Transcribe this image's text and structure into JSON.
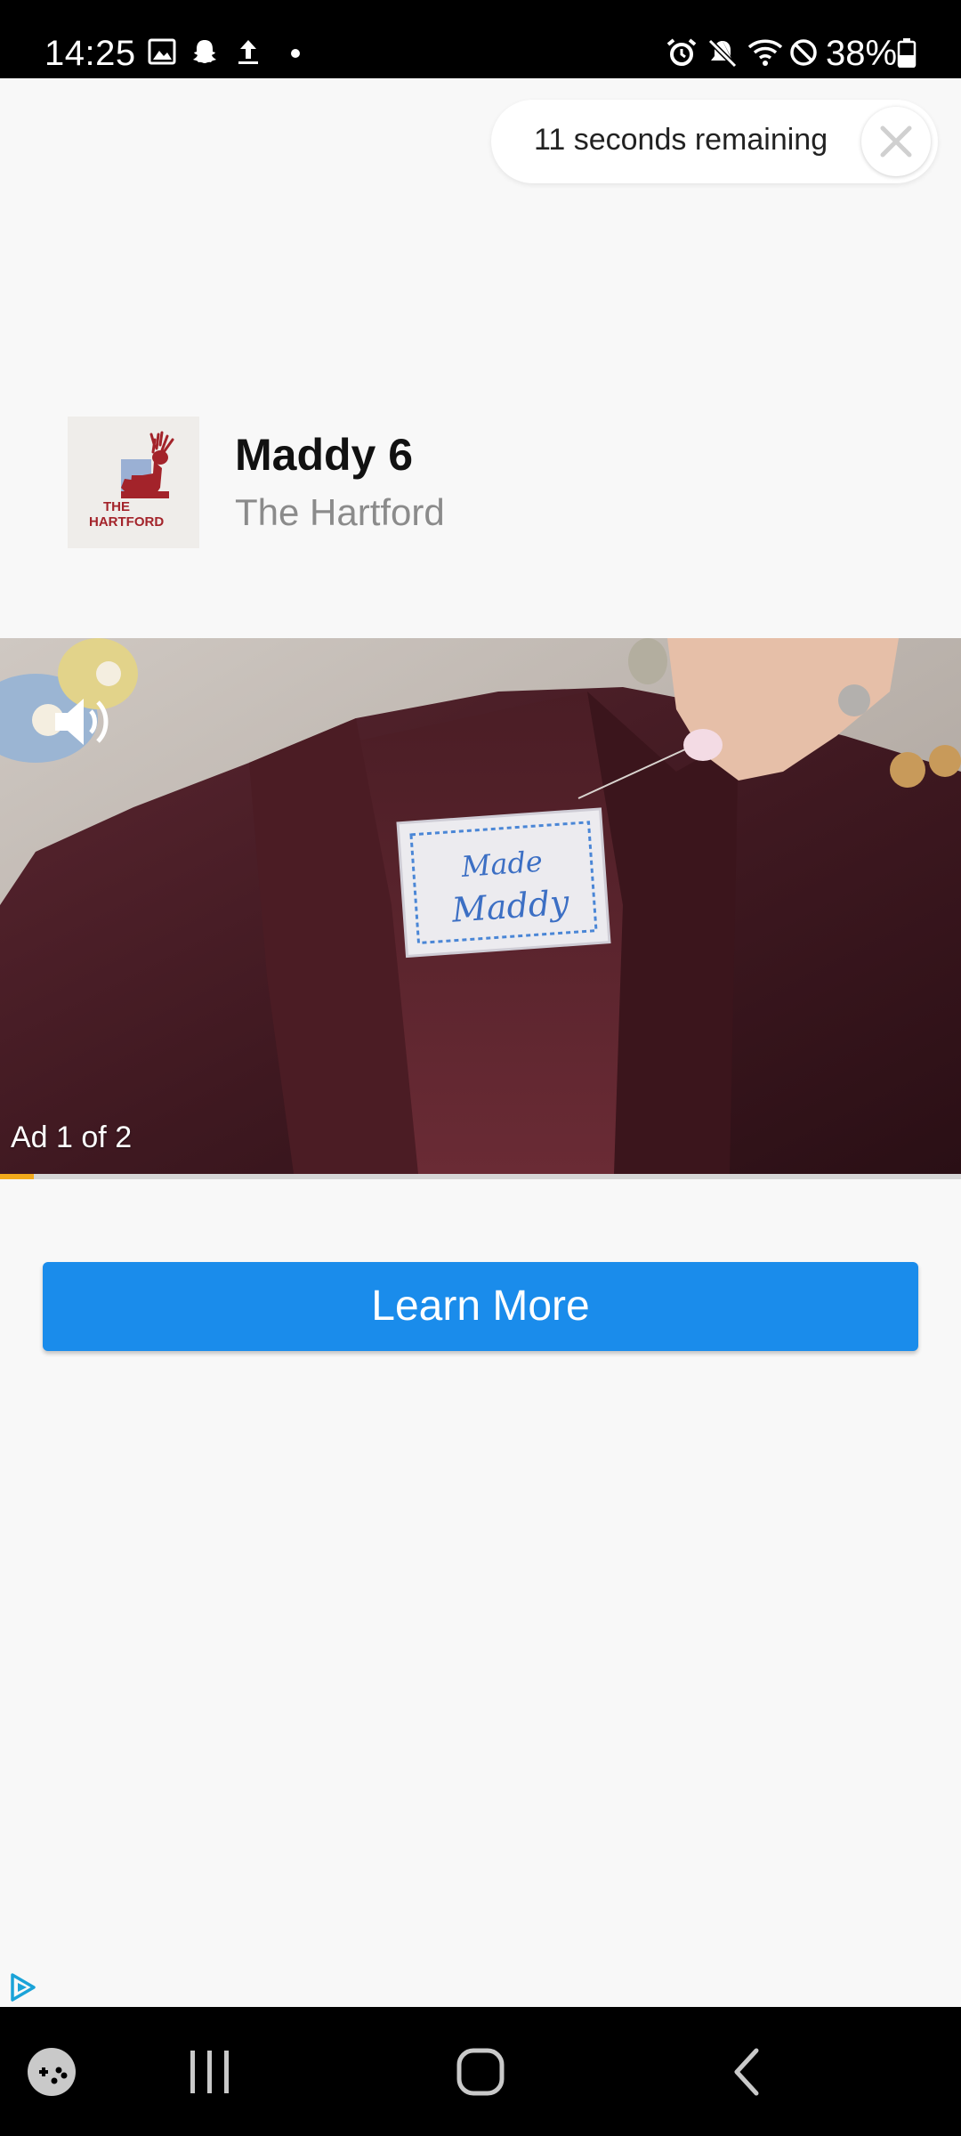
{
  "status_bar": {
    "time": "14:25",
    "battery_percent": "38%",
    "icons": [
      "gallery-icon",
      "snapchat-icon",
      "upload-icon",
      "dot-icon",
      "alarm-icon",
      "mute-icon",
      "wifi-icon",
      "blocked-icon",
      "battery-icon"
    ]
  },
  "countdown": {
    "text": "11 seconds remaining",
    "close_icon": "close-icon"
  },
  "ad": {
    "title": "Maddy 6",
    "advertiser": "The Hartford",
    "logo_text_line1": "THE",
    "logo_text_line2": "HARTFORD",
    "counter": "Ad 1 of 2",
    "label_text_line1": "Made",
    "label_text_line2": "Maddy",
    "progress_percent": 3.5
  },
  "cta": {
    "label": "Learn More"
  },
  "colors": {
    "accent": "#1a8ceb",
    "progress": "#f2a91b",
    "brand_red": "#a3232a"
  },
  "nav_bar": {
    "items": [
      "game-launcher-icon",
      "recents-icon",
      "home-icon",
      "back-icon"
    ]
  }
}
